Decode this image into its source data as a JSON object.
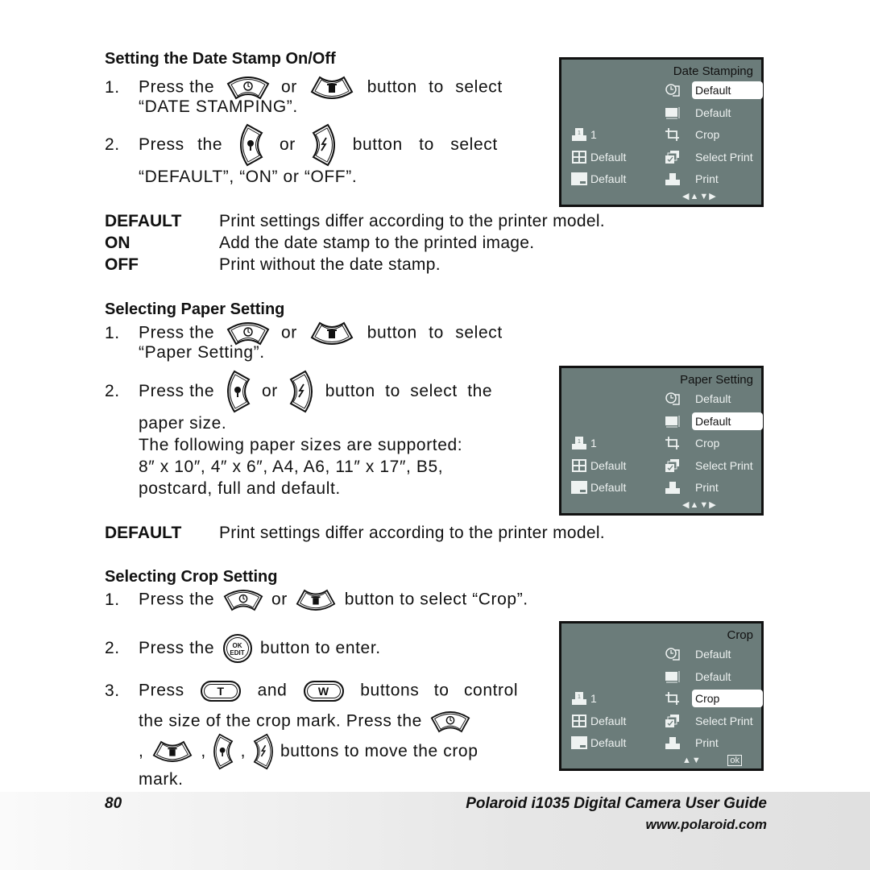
{
  "sections": {
    "date_stamp": {
      "heading": "Setting the Date Stamp On/Off",
      "step1_num": "1.",
      "step1_a": "Press the",
      "step1_or": "or",
      "step1_b": "button to select",
      "step1_c": "“DATE STAMPING”.",
      "step2_num": "2.",
      "step2_a": "Press the",
      "step2_or": "or",
      "step2_b": "button to select",
      "step2_c": "“DEFAULT”, “ON” or “OFF”.",
      "definitions": [
        {
          "key": "DEFAULT",
          "value": "Print settings differ according to the printer model."
        },
        {
          "key": "ON",
          "value": "Add the date stamp to the printed image."
        },
        {
          "key": "OFF",
          "value": "Print without the date stamp."
        }
      ]
    },
    "paper": {
      "heading": "Selecting Paper Setting",
      "step1_num": "1.",
      "step1_a": "Press the",
      "step1_or": "or",
      "step1_b": "button to select",
      "step1_c": "“Paper Setting”.",
      "step2_num": "2.",
      "step2_a": "Press the",
      "step2_or": "or",
      "step2_b": "button to select the",
      "step2_c": "paper size.",
      "step2_d": "The following paper sizes are supported:",
      "step2_e": "8″ x 10″, 4″ x 6″, A4, A6, 11″ x 17″, B5,",
      "step2_f": "postcard, full and default.",
      "definitions": [
        {
          "key": "DEFAULT",
          "value": "Print settings differ according to the printer model."
        }
      ]
    },
    "crop": {
      "heading": "Selecting Crop Setting",
      "step1_num": "1.",
      "step1_a": "Press the",
      "step1_or": "or",
      "step1_b": "button to select “Crop”.",
      "step2_num": "2.",
      "step2_a": "Press the",
      "step2_b": "button to enter.",
      "step3_num": "3.",
      "step3_a": "Press",
      "step3_and": "and",
      "step3_b": "buttons to control",
      "step3_c": "the size of the crop mark. Press the",
      "step3_d": "buttons to move the crop",
      "step3_e": "mark.",
      "comma": ","
    }
  },
  "button_labels": {
    "ok_edit_top": "OK",
    "ok_edit_bottom": "EDIT",
    "tele": "T",
    "wide": "W"
  },
  "lcd_screens": [
    {
      "title": "Date Stamping",
      "right_items": [
        "Default",
        "Default",
        "Crop",
        "Select Print",
        "Print"
      ],
      "right_icons": [
        "date-stamp-icon",
        "paper-size-icon",
        "crop-icon",
        "select-print-icon",
        "print-icon"
      ],
      "selected_index": 0,
      "left_items": [
        "1",
        "Default",
        "Default"
      ],
      "left_icons": [
        "copies-icon",
        "layout-icon",
        "quality-icon"
      ],
      "nav": "◀▲▼▶",
      "ok": ""
    },
    {
      "title": "Paper Setting",
      "right_items": [
        "Default",
        "Default",
        "Crop",
        "Select Print",
        "Print"
      ],
      "right_icons": [
        "date-stamp-icon",
        "paper-size-icon",
        "crop-icon",
        "select-print-icon",
        "print-icon"
      ],
      "selected_index": 1,
      "left_items": [
        "1",
        "Default",
        "Default"
      ],
      "left_icons": [
        "copies-icon",
        "layout-icon",
        "quality-icon"
      ],
      "nav": "◀▲▼▶",
      "ok": ""
    },
    {
      "title": "Crop",
      "right_items": [
        "Default",
        "Default",
        "Crop",
        "Select Print",
        "Print"
      ],
      "right_icons": [
        "date-stamp-icon",
        "paper-size-icon",
        "crop-icon",
        "select-print-icon",
        "print-icon"
      ],
      "selected_index": 2,
      "left_items": [
        "1",
        "Default",
        "Default"
      ],
      "left_icons": [
        "copies-icon",
        "layout-icon",
        "quality-icon"
      ],
      "nav": "▲▼",
      "ok": "ok"
    }
  ],
  "footer": {
    "page_number": "80",
    "guide_title": "Polaroid i1035 Digital Camera User Guide",
    "url": "www.polaroid.com"
  }
}
